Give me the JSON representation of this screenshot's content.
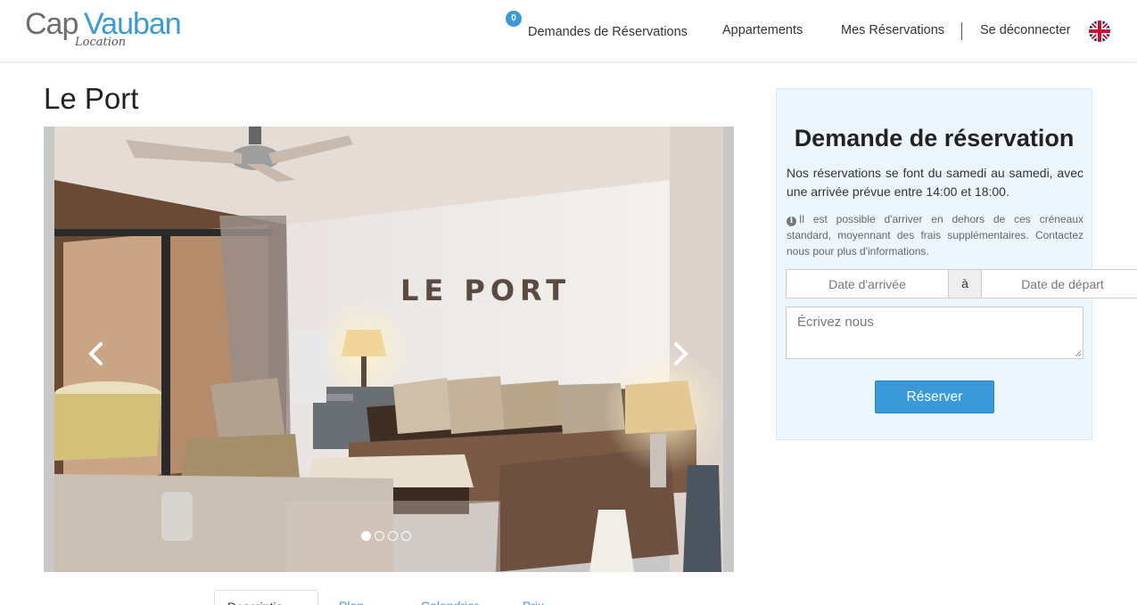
{
  "brand": {
    "logo_part1": "Cap",
    "logo_part2": "Vauban",
    "logo_sub": "Location",
    "accent": "#3a9ad9"
  },
  "nav": {
    "badge_count": "0",
    "items": [
      {
        "label": "Demandes de Réservations"
      },
      {
        "label": "Appartements"
      },
      {
        "label": "Mes Réservations"
      },
      {
        "label": "Se déconnecter"
      }
    ],
    "language_icon": "uk-flag-icon"
  },
  "page": {
    "title": "Le Port"
  },
  "carousel": {
    "photo_sign_text": "LE PORT",
    "slide_count": 4,
    "active_slide": 1,
    "prev_icon": "chevron-left-icon",
    "next_icon": "chevron-right-icon"
  },
  "booking": {
    "title": "Demande de réservation",
    "description": "Nos réservations se font du samedi au samedi, avec une arrivée prévue entre 14:00 et 18:00.",
    "info": "Il est possible d'arriver en dehors de ces créneaux standard, moyennant des frais supplémentaires. Contactez nous pour plus d'informations.",
    "info_icon": "info-icon",
    "arrival_placeholder": "Date d'arrivée",
    "to_label": "à",
    "departure_placeholder": "Date de départ",
    "message_placeholder": "Écrivez nous",
    "submit_label": "Réserver",
    "panel_bg": "#eef6fd"
  },
  "tabs": {
    "items": [
      {
        "label": "Descriptio"
      },
      {
        "label": "Plan"
      },
      {
        "label": "Calendrier"
      },
      {
        "label": "Prix"
      }
    ]
  }
}
